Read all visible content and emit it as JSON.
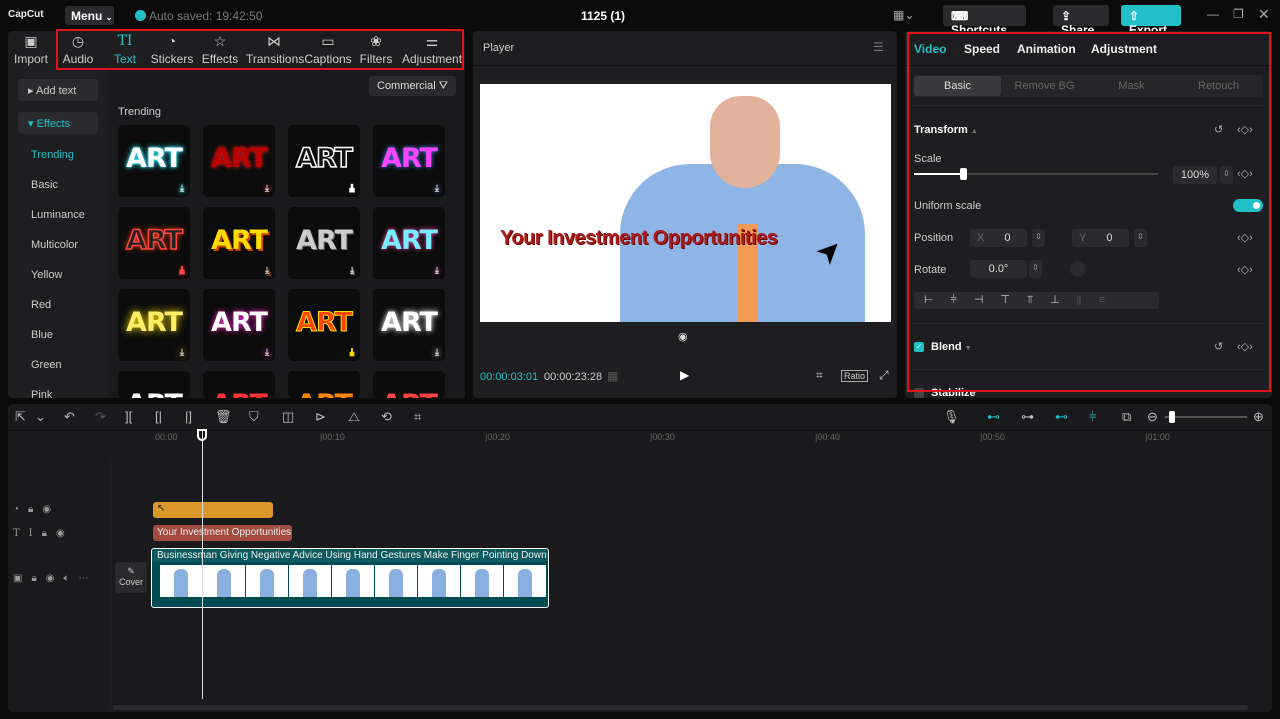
{
  "app": {
    "logo": "CapCut",
    "menu": "Menu",
    "autosave": "Auto saved: 19:42:50",
    "project_title": "1125 (1)",
    "shortcuts": "Shortcuts",
    "share": "Share",
    "export": "Export",
    "accent": "#21c0c8"
  },
  "toolbar": {
    "items": [
      {
        "label": "Import",
        "icon": "import-icon"
      },
      {
        "label": "Audio",
        "icon": "audio-icon"
      },
      {
        "label": "Text",
        "icon": "text-icon"
      },
      {
        "label": "Stickers",
        "icon": "stickers-icon"
      },
      {
        "label": "Effects",
        "icon": "effects-icon"
      },
      {
        "label": "Transitions",
        "icon": "transitions-icon"
      },
      {
        "label": "Captions",
        "icon": "captions-icon"
      },
      {
        "label": "Filters",
        "icon": "filters-icon"
      },
      {
        "label": "Adjustment",
        "icon": "adjustment-icon"
      }
    ]
  },
  "text_panel": {
    "add_text": "Add text",
    "effects": "Effects",
    "categories": [
      "Trending",
      "Basic",
      "Luminance",
      "Multicolor",
      "Yellow",
      "Red",
      "Blue",
      "Green",
      "Pink"
    ],
    "filter": "Commercial",
    "section": "Trending",
    "tile_label": "ART"
  },
  "player": {
    "title": "Player",
    "overlay_text": "Your Investment Opportunities",
    "current_time": "00:00:03:01",
    "total_time": "00:00:23:28",
    "ratio": "Ratio"
  },
  "inspector": {
    "tabs": [
      "Video",
      "Speed",
      "Animation",
      "Adjustment"
    ],
    "subtabs": [
      "Basic",
      "Remove BG",
      "Mask",
      "Retouch"
    ],
    "transform": "Transform",
    "scale_label": "Scale",
    "scale_value": "100%",
    "scale_fraction": 0.2,
    "uniform_scale": "Uniform scale",
    "uniform_on": true,
    "position": "Position",
    "x_label": "X",
    "x_value": "0",
    "y_label": "Y",
    "y_value": "0",
    "rotate": "Rotate",
    "rotate_value": "0.0°",
    "blend": "Blend",
    "stabilize": "Stabilize"
  },
  "timeline": {
    "ruler": [
      "00:00",
      "|00:10",
      "|00:20",
      "|00:30",
      "|00:40",
      "|00:50",
      "|01:00"
    ],
    "text_clip": "Your Investment Opportunities",
    "video_clip": "Businessman Giving Negative Advice Using Hand Gestures Make Finger Pointing Down",
    "cover": "Cover"
  }
}
